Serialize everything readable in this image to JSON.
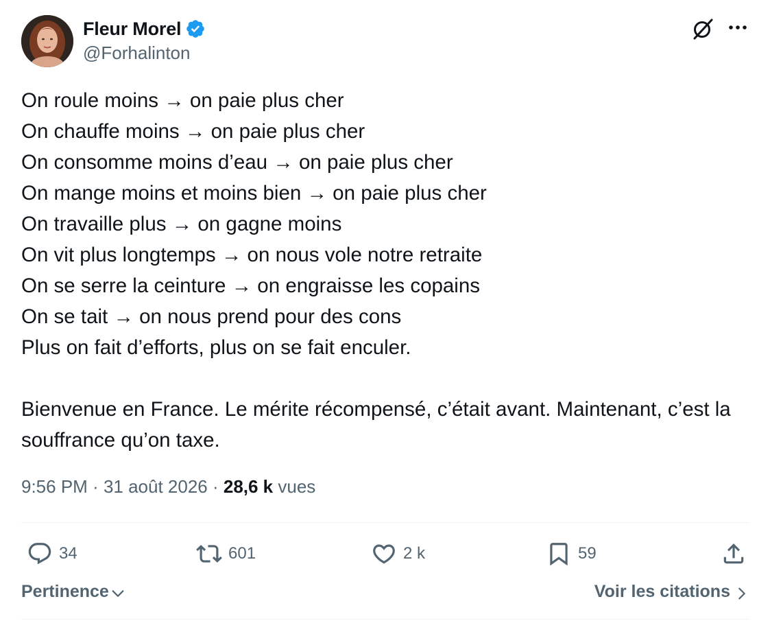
{
  "author": {
    "display_name": "Fleur Morel",
    "handle": "@Forhalinton",
    "verified": true
  },
  "tweet": {
    "lines": [
      "On roule moins → on paie plus cher",
      "On chauffe moins → on paie plus cher",
      "On consomme moins d’eau → on paie plus cher",
      "On mange moins et moins bien → on paie plus cher",
      "On travaille plus → on gagne moins",
      "On vit plus longtemps → on nous vole notre retraite",
      "On se serre la ceinture → on engraisse les copains",
      "On se tait → on nous prend pour des cons",
      "Plus on fait d’efforts, plus on se fait enculer."
    ],
    "closing": "Bienvenue en France. Le mérite récompensé, c’était avant. Maintenant, c’est la souffrance qu’on taxe."
  },
  "meta": {
    "time": "9:56 PM",
    "separator": " · ",
    "date": "31 août 2026",
    "views_count": "28,6 k",
    "views_label": " vues"
  },
  "actions": {
    "replies": "34",
    "reposts": "601",
    "likes": "2 k",
    "bookmarks": "59"
  },
  "footer": {
    "sort_label": "Pertinence",
    "quotes_label": "Voir les citations"
  },
  "colors": {
    "text_primary": "#0f1419",
    "text_secondary": "#536471",
    "verified_blue": "#1d9bf0",
    "divider": "#eff3f4"
  },
  "icons": {
    "verified": "verified-badge-icon",
    "grok": "grok-icon",
    "more": "more-icon",
    "reply": "reply-icon",
    "repost": "repost-icon",
    "like": "heart-icon",
    "bookmark": "bookmark-icon",
    "share": "share-icon",
    "sort": "chevron-down-icon",
    "quotes": "chevron-right-icon"
  }
}
